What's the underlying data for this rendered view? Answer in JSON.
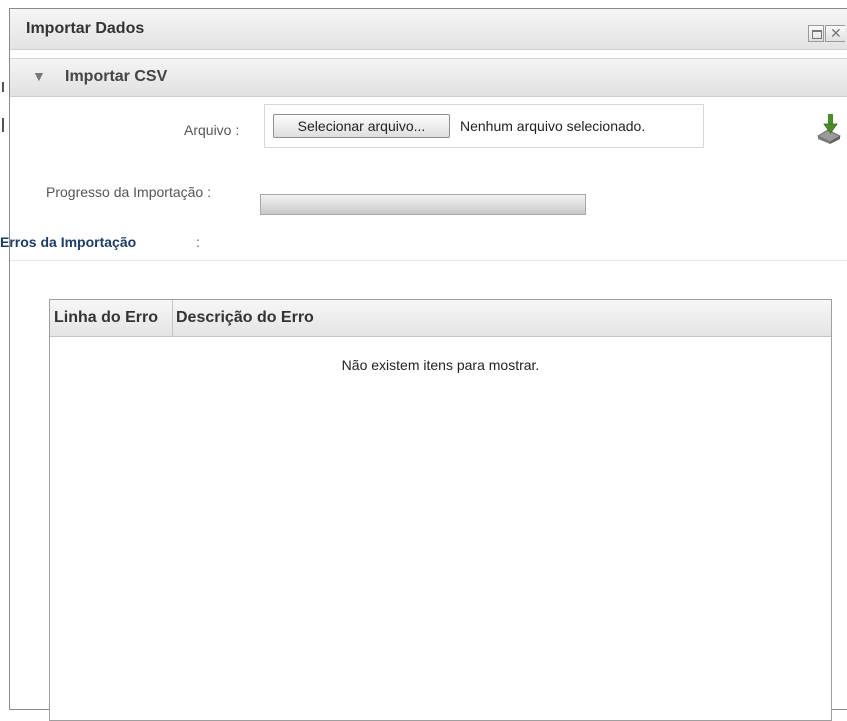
{
  "window": {
    "title": "Importar Dados"
  },
  "panel": {
    "title": "Importar CSV"
  },
  "file_input": {
    "label": "Arquivo :",
    "button_label": "Selecionar arquivo...",
    "status": "Nenhum arquivo selecionado."
  },
  "progress": {
    "label": "Progresso da Importação :",
    "value": 0
  },
  "errors": {
    "title": "Erros da Importação",
    "colon": ":",
    "columns": [
      "Linha do Erro",
      "Descrição do Erro"
    ],
    "empty_message": "Não existem itens para mostrar."
  },
  "icons": {
    "collapse": "chevron-down-icon",
    "maximize": "maximize-icon",
    "close": "close-icon",
    "download": "download-icon"
  },
  "colors": {
    "title_text": "#333333",
    "errors_title": "#1d3c64",
    "grid_border": "#9f9f9f"
  }
}
